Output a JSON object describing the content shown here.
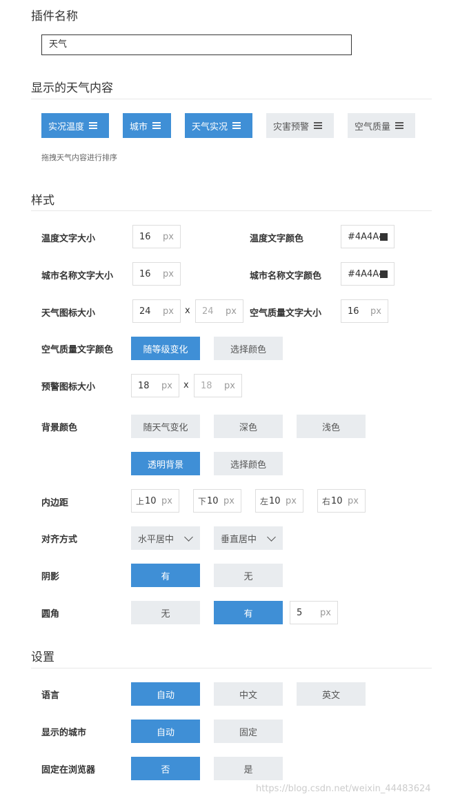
{
  "plugin_name": {
    "title": "插件名称",
    "value": "天气"
  },
  "content": {
    "title": "显示的天气内容",
    "chips": [
      {
        "label": "实况温度",
        "active": true
      },
      {
        "label": "城市",
        "active": true
      },
      {
        "label": "天气实况",
        "active": true
      },
      {
        "label": "灾害预警",
        "active": false
      },
      {
        "label": "空气质量",
        "active": false
      }
    ],
    "hint": "拖拽天气内容进行排序"
  },
  "style": {
    "title": "样式",
    "temp_size": {
      "label": "温度文字大小",
      "value": "16",
      "unit": "px"
    },
    "temp_color": {
      "label": "温度文字颜色",
      "value": "#4A4A4A"
    },
    "city_size": {
      "label": "城市名称文字大小",
      "value": "16",
      "unit": "px"
    },
    "city_color": {
      "label": "城市名称文字颜色",
      "value": "#4A4A4A"
    },
    "icon_size": {
      "label": "天气图标大小",
      "w": "24",
      "h": "24",
      "unit": "px",
      "times": "x"
    },
    "aq_size": {
      "label": "空气质量文字大小",
      "value": "16",
      "unit": "px"
    },
    "aq_color": {
      "label": "空气质量文字颜色",
      "options": [
        "随等级变化",
        "选择颜色"
      ]
    },
    "warn_icon": {
      "label": "预警图标大小",
      "w": "18",
      "h": "18",
      "unit": "px",
      "times": "x"
    },
    "bg": {
      "label": "背景颜色",
      "options": [
        "随天气变化",
        "深色",
        "浅色",
        "透明背景",
        "选择颜色"
      ]
    },
    "padding": {
      "label": "内边距",
      "items": [
        {
          "prefix": "上",
          "value": "10",
          "unit": "px"
        },
        {
          "prefix": "下",
          "value": "10",
          "unit": "px"
        },
        {
          "prefix": "左",
          "value": "10",
          "unit": "px"
        },
        {
          "prefix": "右",
          "value": "10",
          "unit": "px"
        }
      ]
    },
    "align": {
      "label": "对齐方式",
      "horizontal": "水平居中",
      "vertical": "垂直居中"
    },
    "shadow": {
      "label": "阴影",
      "options": [
        "有",
        "无"
      ]
    },
    "radius": {
      "label": "圆角",
      "options": [
        "无",
        "有"
      ],
      "value": "5",
      "unit": "px"
    }
  },
  "settings": {
    "title": "设置",
    "language": {
      "label": "语言",
      "options": [
        "自动",
        "中文",
        "英文"
      ]
    },
    "city": {
      "label": "显示的城市",
      "options": [
        "自动",
        "固定"
      ]
    },
    "pin": {
      "label": "固定在浏览器",
      "options": [
        "否",
        "是"
      ]
    }
  },
  "watermark": "https://blog.csdn.net/weixin_44483624",
  "colors": {
    "accent": "#3f8fd6",
    "inactive": "#e9ecef"
  }
}
